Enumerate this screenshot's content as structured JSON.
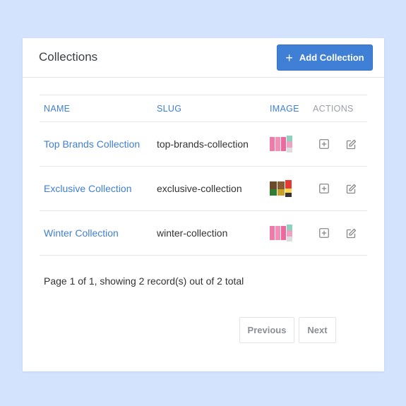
{
  "header": {
    "title": "Collections",
    "add_button_label": "Add Collection",
    "add_button_icon": "plus-icon"
  },
  "table": {
    "columns": [
      "NAME",
      "SLUG",
      "IMAGE",
      "ACTIONS"
    ],
    "rows": [
      {
        "name": "Top Brands Collection",
        "slug": "top-brands-collection",
        "image": "pink-products-thumbnail"
      },
      {
        "name": "Exclusive Collection",
        "slug": "exclusive-collection",
        "image": "dog-products-thumbnail"
      },
      {
        "name": "Winter Collection",
        "slug": "winter-collection",
        "image": "pink-products-thumbnail"
      }
    ],
    "row_action_icons": [
      "plus-square-icon",
      "edit-icon"
    ]
  },
  "pagination": {
    "summary": "Page 1 of 1, showing 2 record(s) out of 2 total",
    "previous_label": "Previous",
    "next_label": "Next"
  },
  "colors": {
    "accent": "#3f7fd6",
    "background": "#d3e3fd"
  }
}
